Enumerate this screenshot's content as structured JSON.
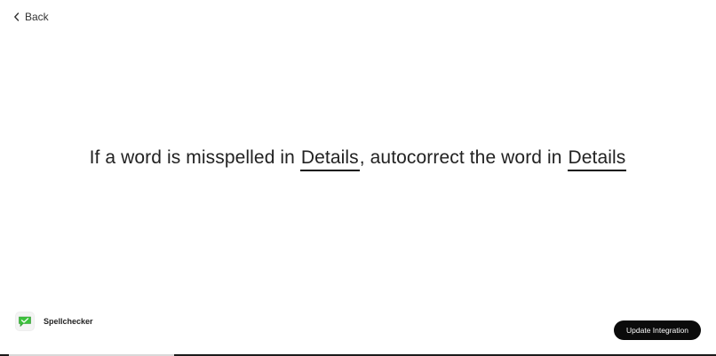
{
  "nav": {
    "back_label": "Back",
    "back_icon": "chevron-left-icon"
  },
  "rule": {
    "part1": "If a word is misspelled in",
    "field1": "Details",
    "part2": ", autocorrect the word in",
    "field2": "Details"
  },
  "app": {
    "name": "Spellchecker",
    "logo_icon": "spellchecker-logo-icon",
    "logo_color": "#3cc23c"
  },
  "actions": {
    "update_label": "Update Integration"
  }
}
